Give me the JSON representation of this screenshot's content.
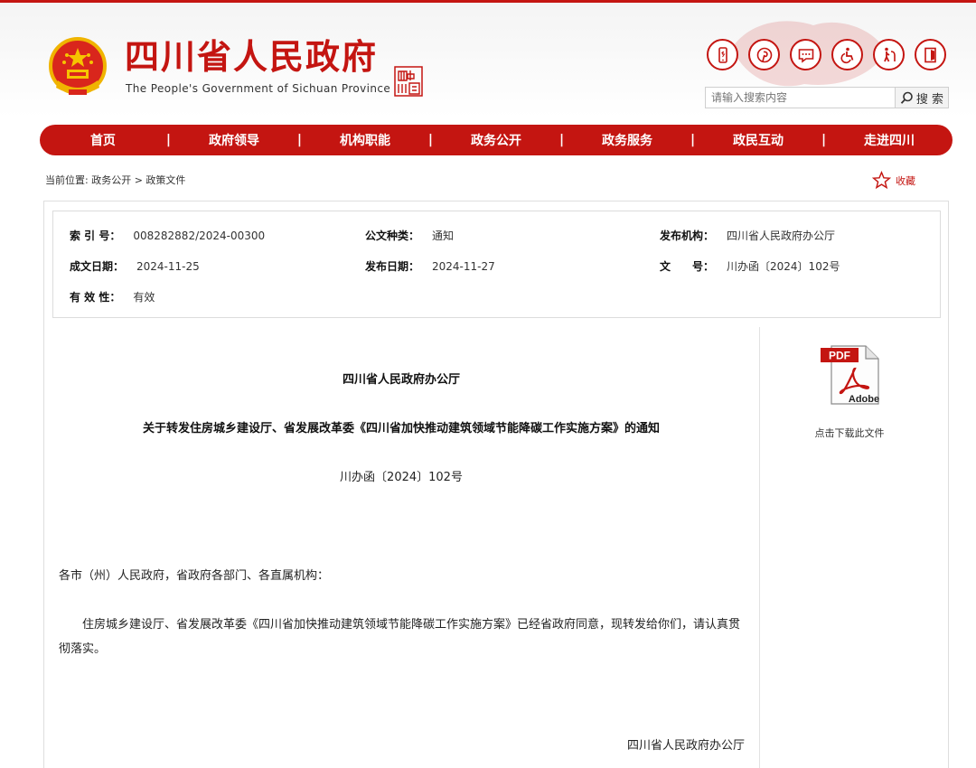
{
  "header": {
    "title": "四川省人民政府",
    "subtitle": "The People's Government of Sichuan Province",
    "seal_text": "四川中國",
    "icons": [
      "mobile-icon",
      "pinterest-icon",
      "message-icon",
      "accessibility-icon",
      "elderly-icon",
      "exit-icon"
    ]
  },
  "search": {
    "placeholder": "请输入搜索内容",
    "button_label": "搜 索"
  },
  "nav": {
    "items": [
      "首页",
      "政府领导",
      "机构职能",
      "政务公开",
      "政务服务",
      "政民互动",
      "走进四川"
    ],
    "separator": "|"
  },
  "breadcrumb": "当前位置: 政务公开 > 政策文件",
  "favorite_label": "收藏",
  "meta": {
    "index_label": "索 引 号：",
    "index_value": "008282882/2024-00300",
    "type_label": "公文种类：",
    "type_value": "通知",
    "org_label": "发布机构：",
    "org_value": "四川省人民政府办公厅",
    "created_label": "成文日期：",
    "created_value": "2024-11-25",
    "published_label": "发布日期：",
    "published_value": "2024-11-27",
    "docno_label": "文　　号：",
    "docno_value": "川办函〔2024〕102号",
    "validity_label": "有 效 性：",
    "validity_value": "有效"
  },
  "document": {
    "issuer": "四川省人民政府办公厅",
    "title": "关于转发住房城乡建设厅、省发展改革委《四川省加快推动建筑领域节能降碳工作实施方案》的通知",
    "number": "川办函〔2024〕102号",
    "salutation": "各市（州）人民政府，省政府各部门、各直属机构：",
    "body": "住房城乡建设厅、省发展改革委《四川省加快推动建筑领域节能降碳工作实施方案》已经省政府同意，现转发给你们，请认真贯彻落实。",
    "signature": "四川省人民政府办公厅"
  },
  "download": {
    "pdf_badge": "PDF",
    "adobe_text": "Adobe",
    "label": "点击下载此文件"
  },
  "colors": {
    "brand_red": "#c41511",
    "border_gray": "#dedede"
  }
}
